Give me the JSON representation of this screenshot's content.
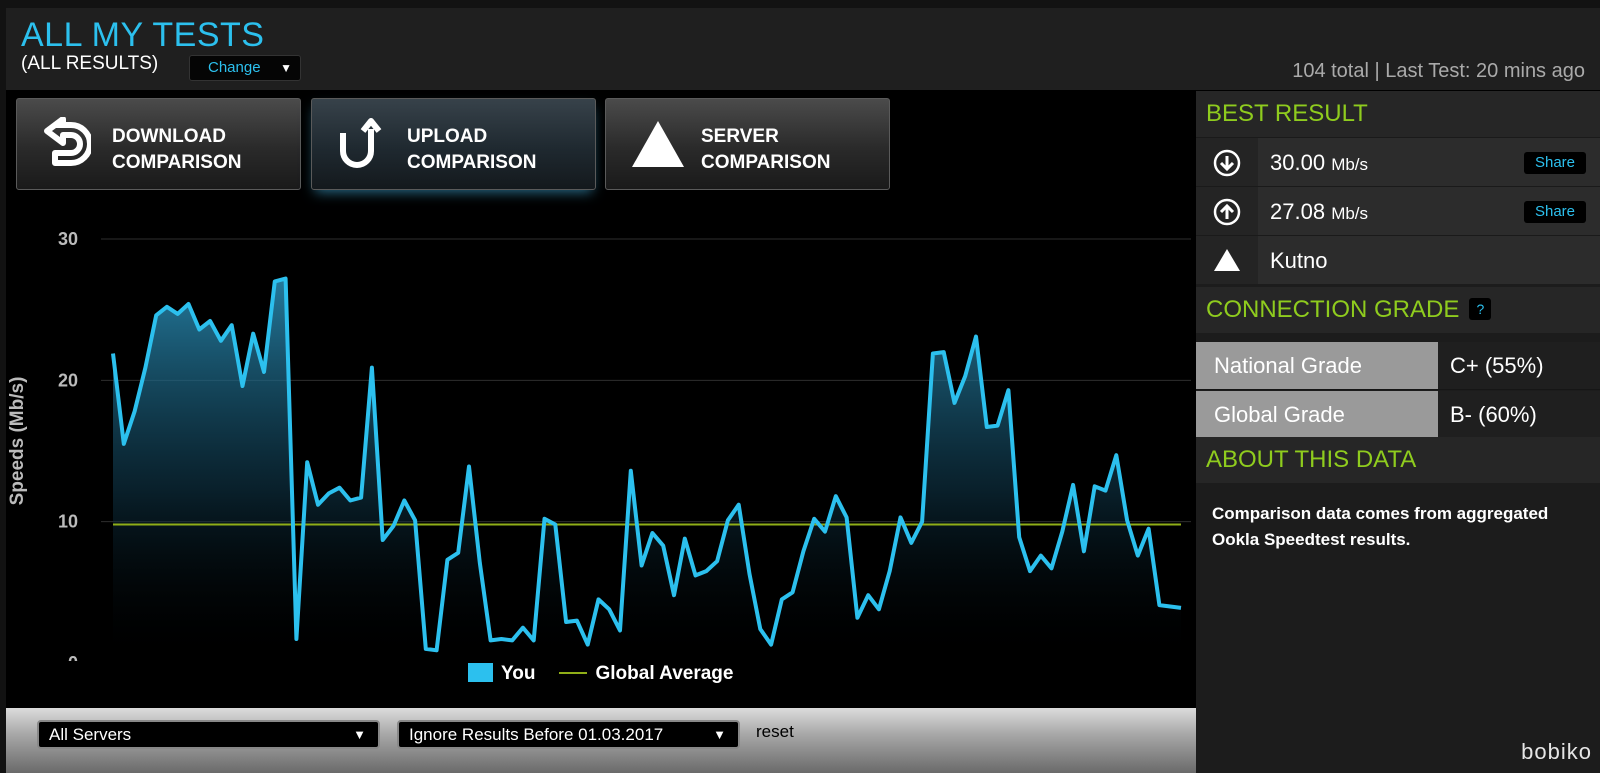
{
  "header": {
    "title": "ALL MY TESTS",
    "subtitle": "(ALL RESULTS)",
    "change_label": "Change",
    "stats": "104 total | Last Test: 20 mins ago"
  },
  "comparison_buttons": [
    {
      "line1": "DOWNLOAD",
      "line2": "COMPARISON",
      "icon": "download-icon"
    },
    {
      "line1": "UPLOAD",
      "line2": "COMPARISON",
      "icon": "upload-icon",
      "active": true
    },
    {
      "line1": "SERVER",
      "line2": "COMPARISON",
      "icon": "server-triangle-icon"
    }
  ],
  "chart_data": {
    "type": "area",
    "ylabel": "Speeds (Mb/s)",
    "ylim": [
      0,
      30
    ],
    "yticks": [
      0,
      10,
      20,
      30
    ],
    "grid": true,
    "legend": [
      "You",
      "Global Average"
    ],
    "legend_position": "bottom-center",
    "global_average": 9.8,
    "series": [
      {
        "name": "You",
        "color": "#2cc0ee",
        "values": [
          21.9,
          15.5,
          17.8,
          20.9,
          24.6,
          25.2,
          24.7,
          25.4,
          23.6,
          24.2,
          22.8,
          23.9,
          19.6,
          23.3,
          20.6,
          27.0,
          27.2,
          1.7,
          14.2,
          11.2,
          12.0,
          12.4,
          11.5,
          11.7,
          20.9,
          8.7,
          9.7,
          11.5,
          10.1,
          1.0,
          0.9,
          7.3,
          7.8,
          13.9,
          7.1,
          1.6,
          1.7,
          1.6,
          2.5,
          1.6,
          10.2,
          9.8,
          2.9,
          3.0,
          1.3,
          4.5,
          3.8,
          2.3,
          13.6,
          6.9,
          9.2,
          8.3,
          4.8,
          8.8,
          6.2,
          6.5,
          7.2,
          10.1,
          11.2,
          6.3,
          2.4,
          1.3,
          4.5,
          5.0,
          7.9,
          10.2,
          9.3,
          11.8,
          10.3,
          3.2,
          4.8,
          3.8,
          6.5,
          10.3,
          8.5,
          10.0,
          21.9,
          22.0,
          18.4,
          20.3,
          23.1,
          16.7,
          16.8,
          19.3,
          8.9,
          6.5,
          7.6,
          6.7,
          9.3,
          12.6,
          7.9,
          12.5,
          12.2,
          14.7,
          10.1,
          7.6,
          9.5,
          4.1,
          4.0,
          3.9
        ]
      },
      {
        "name": "Global Average",
        "color": "#8fae17",
        "values": [
          9.8
        ]
      }
    ]
  },
  "filters": {
    "server": "All Servers",
    "date": "Ignore Results Before 01.03.2017",
    "reset": "reset"
  },
  "best_result": {
    "heading": "BEST RESULT",
    "download_value": "30.00",
    "upload_value": "27.08",
    "unit": "Mb/s",
    "server": "Kutno",
    "share_label": "Share"
  },
  "connection_grade": {
    "heading": "CONNECTION GRADE",
    "help": "?",
    "rows": [
      {
        "label": "National Grade",
        "value": "C+ (55%)"
      },
      {
        "label": "Global Grade",
        "value": "B- (60%)"
      }
    ]
  },
  "about": {
    "heading": "ABOUT THIS DATA",
    "text": "Comparison data comes from aggregated Ookla Speedtest results."
  },
  "brand": "bobiko",
  "colors": {
    "accent": "#2cc0ee",
    "green": "#8fcc1e",
    "avg_line": "#8fae17"
  }
}
